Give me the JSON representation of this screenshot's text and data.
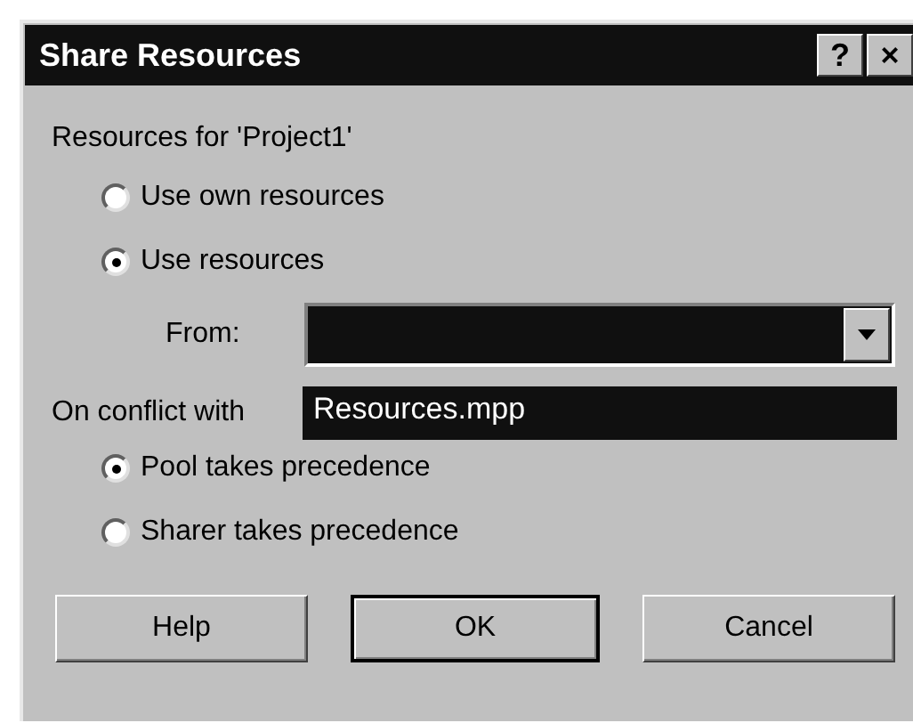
{
  "window": {
    "title": "Share Resources",
    "title_buttons": [
      "?",
      "×"
    ]
  },
  "resources_label": "Resources for 'Project1'",
  "resource_options": [
    {
      "label": "Use own resources",
      "selected": false
    },
    {
      "label": "Use resources",
      "selected": true
    }
  ],
  "from": {
    "label": "From:",
    "expanded": true,
    "options": [
      {
        "label": "Resources.mpp",
        "selected": true
      }
    ]
  },
  "conflict_label": "On conflict with",
  "conflict_options": [
    {
      "label": "Pool takes precedence",
      "selected": true
    },
    {
      "label": "Sharer takes precedence",
      "selected": false
    }
  ],
  "buttons": [
    {
      "label": "Help",
      "default": false
    },
    {
      "label": "OK",
      "default": true
    },
    {
      "label": "Cancel",
      "default": false
    }
  ]
}
